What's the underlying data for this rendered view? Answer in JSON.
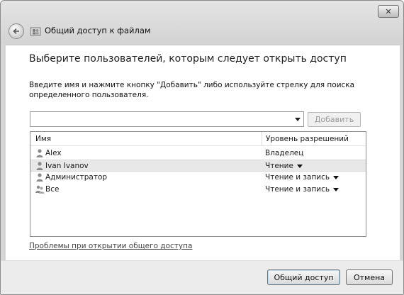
{
  "window": {
    "close_glyph": "✕"
  },
  "nav": {
    "back_glyph": "←",
    "title": "Общий доступ к файлам"
  },
  "main": {
    "heading": "Выберите пользователей, которым следует открыть доступ",
    "instructions": "Введите имя и нажмите кнопку \"Добавить\" либо используйте стрелку для поиска определенного пользователя.",
    "combo": {
      "value": ""
    },
    "add_button": "Добавить",
    "list": {
      "columns": [
        "Имя",
        "Уровень разрешений"
      ],
      "rows": [
        {
          "name": "Alex",
          "permission": "Владелец",
          "icon": "user-icon",
          "dropdown": false,
          "selected": false
        },
        {
          "name": "Ivan Ivanov",
          "permission": "Чтение",
          "icon": "user-icon",
          "dropdown": true,
          "selected": true
        },
        {
          "name": "Администратор",
          "permission": "Чтение и запись",
          "icon": "user-icon",
          "dropdown": true,
          "selected": false
        },
        {
          "name": "Все",
          "permission": "Чтение и запись",
          "icon": "group-icon",
          "dropdown": true,
          "selected": false
        }
      ]
    },
    "help_link": "Проблемы при открытии общего доступа"
  },
  "footer": {
    "share_button": "Общий доступ",
    "cancel_button": "Отмена"
  },
  "colors": {
    "chrome": "#d6d6d6",
    "content_bg": "#ffffff",
    "selected_row": "#e8e8e8",
    "disabled_text": "#9a9a9a"
  }
}
